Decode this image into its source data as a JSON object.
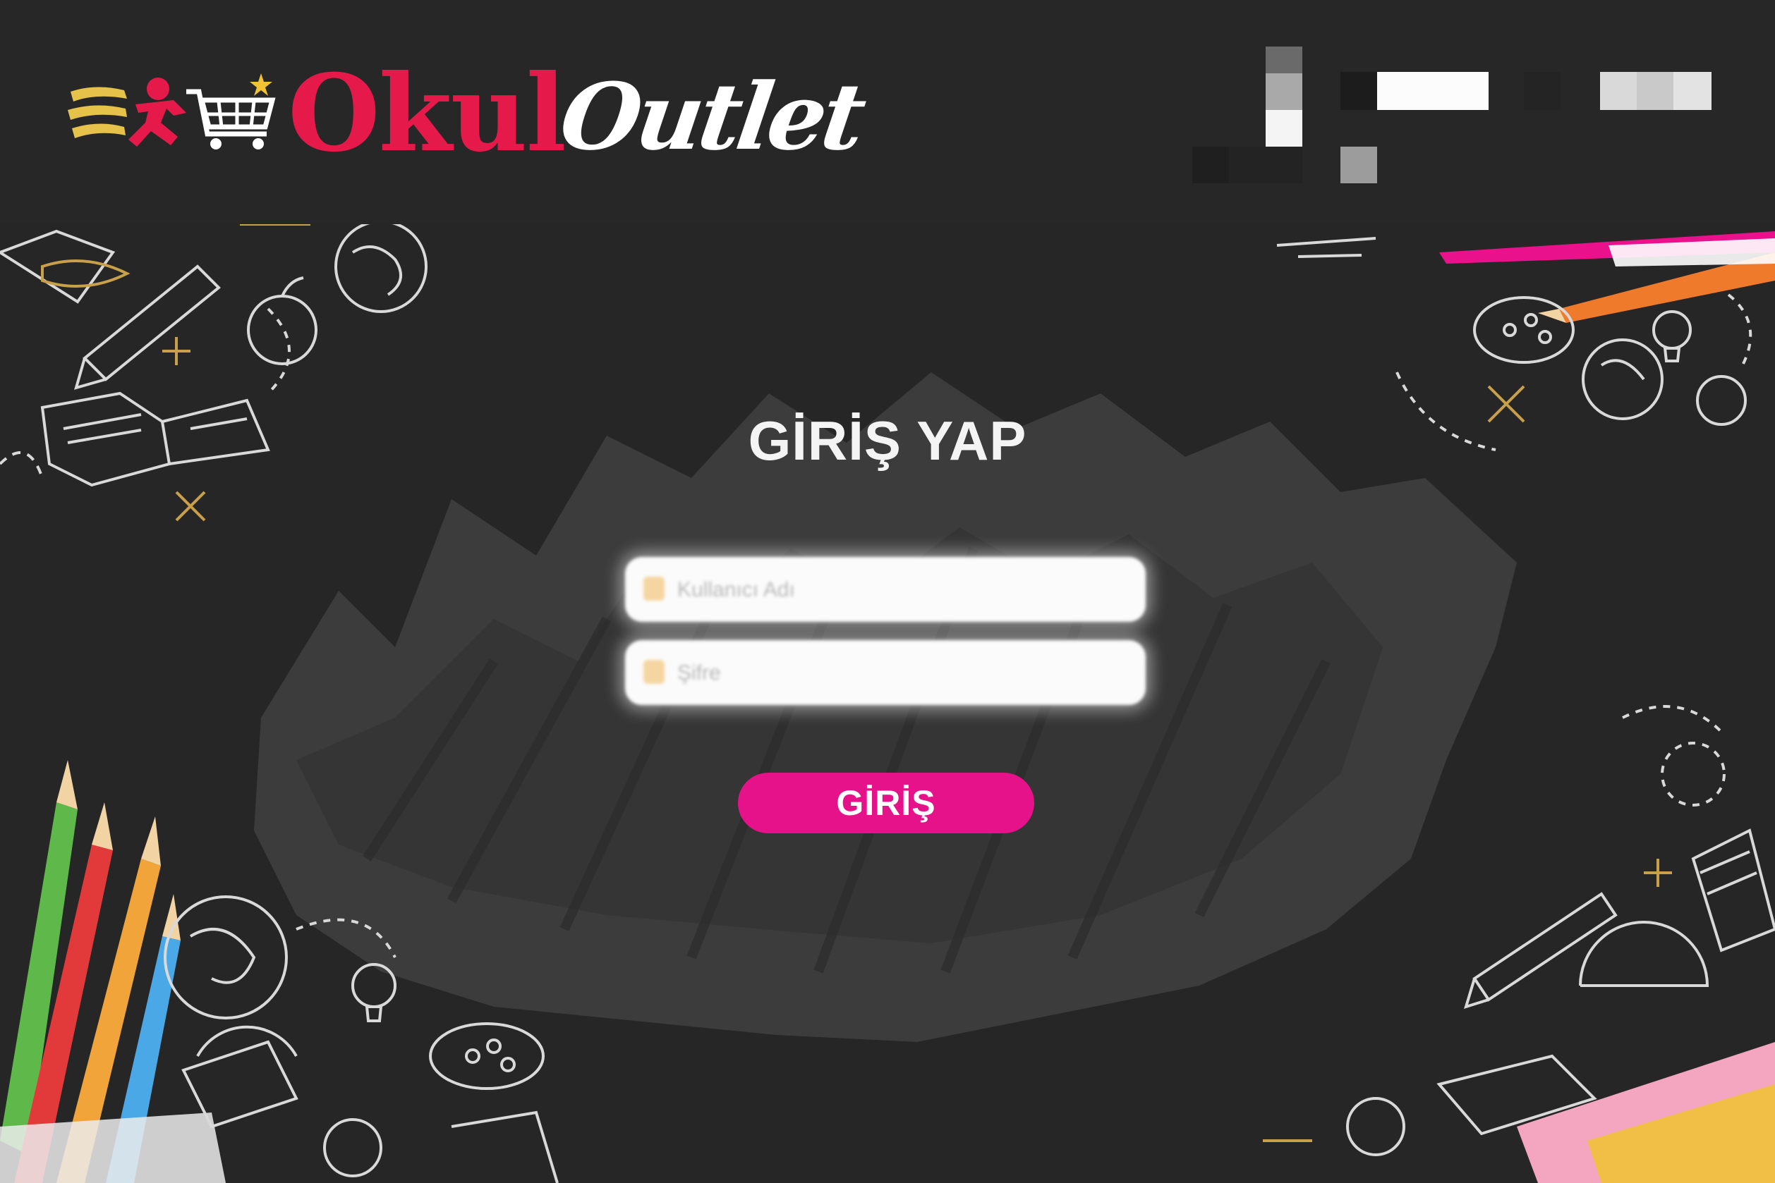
{
  "header": {
    "logo_okul": "Okul",
    "logo_outlet": "Outlet",
    "logo_icon": "running-man-cart-icon"
  },
  "login": {
    "title": "GİRİŞ YAP",
    "username_placeholder": "Kullanıcı Adı",
    "password_placeholder": "Şifre",
    "submit_label": "GİRİŞ"
  },
  "colors": {
    "brand_red": "#e5194a",
    "button_pink": "#e5128a",
    "background": "#262626",
    "header": "#272727"
  }
}
